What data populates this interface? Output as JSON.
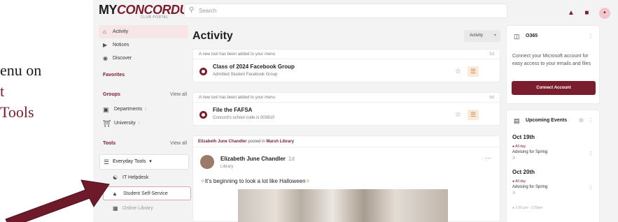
{
  "doc_text": {
    "line1": "enu on",
    "line2": "t",
    "line3": "Tools"
  },
  "header": {
    "logo_prefix": "MY",
    "logo_brand": "CONCORDU",
    "logo_sub": "CLUB PORTAL",
    "search_placeholder": "Search",
    "avatar_initial": "•"
  },
  "sidebar": {
    "nav": [
      {
        "label": "Activity",
        "icon": "home-icon"
      },
      {
        "label": "Notices",
        "icon": "megaphone-icon"
      },
      {
        "label": "Discover",
        "icon": "compass-icon"
      }
    ],
    "favorites_label": "Favorites",
    "groups_label": "Groups",
    "groups_view_all": "View all",
    "groups": [
      {
        "label": "Departments",
        "icon": "building-icon"
      },
      {
        "label": "University",
        "icon": "university-icon"
      }
    ],
    "tools_label": "Tools",
    "tools_view_all": "View all",
    "tools_parent": "Everyday Tools",
    "tools_children": [
      {
        "label": "IT Helpdesk",
        "icon": "headset-icon"
      },
      {
        "label": "Student Self-Service",
        "icon": "graduation-cap-icon"
      },
      {
        "label": "Online Library",
        "icon": "book-icon"
      }
    ]
  },
  "feed": {
    "title": "Activity",
    "filter_label": "Activity",
    "cards": [
      {
        "note": "A new tool has been added to your menu",
        "time": "5d",
        "title": "Class of 2024 Facebook Group",
        "subtitle": "Admitted Student Facebook Group"
      },
      {
        "note": "A new tool has been added to your menu",
        "time": "6d",
        "title": "File the FAFSA",
        "subtitle": "Concord's school code is 003810"
      }
    ],
    "post": {
      "author_link": "Elizabeth June Chandler",
      "posted_in": "posted in",
      "location": "Marsh Library",
      "name": "Elizabeth June Chandler",
      "time": "1d",
      "role": "Library",
      "text": "It's beginning to look a lot like Halloween"
    }
  },
  "rail": {
    "o365": {
      "title": "O365",
      "desc": "Connect your Microsoft account for easy access to your emails and files",
      "button": "Connect Account"
    },
    "events": {
      "title": "Upcoming Events",
      "items": [
        {
          "date": "Oct 19th",
          "allday": "All day",
          "title": "Advising for Spring",
          "meta": "3f"
        },
        {
          "date": "Oct 20th",
          "allday": "All day",
          "title": "Advising for Spring",
          "meta": "3f"
        }
      ],
      "next_time": "1:00 pm - 2:00pm"
    }
  },
  "colors": {
    "brand": "#7a1d2e",
    "arrow": "#6e1a2b"
  }
}
